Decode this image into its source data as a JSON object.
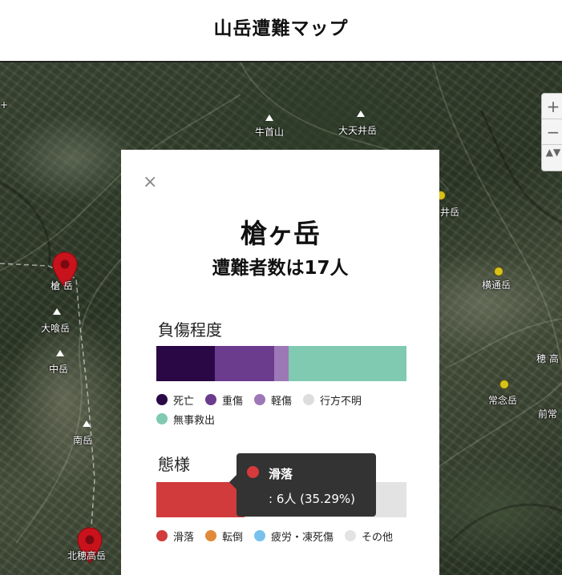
{
  "header": {
    "title": "山岳遭難マップ"
  },
  "map": {
    "labels": {
      "gyukubiyama": "牛首山",
      "daitenjo": "大天井岳",
      "ji_fragment": "井岳",
      "yokotoshi": "横通岳",
      "hotaka": "穂 高",
      "jonen": "常念岳",
      "mae": "前常",
      "yari": "槍 岳",
      "obami": "大喰岳",
      "naka": "中岳",
      "minami": "南岳",
      "kitaho": "北穂高岳"
    },
    "zoom": {
      "in": "+",
      "out": "−",
      "reset": "▲▼"
    }
  },
  "popup": {
    "close": "×",
    "title": "槍ヶ岳",
    "subtitle": "遭難者数は17人",
    "injury": {
      "heading": "負傷程度",
      "segments": [
        {
          "name": "死亡",
          "color": "#2a0845",
          "value": 4
        },
        {
          "name": "重傷",
          "color": "#6b3b8d",
          "value": 4
        },
        {
          "name": "軽傷",
          "color": "#9d78b6",
          "value": 1
        },
        {
          "name": "行方不明",
          "color": "#dddddd",
          "value": 0
        },
        {
          "name": "無事救出",
          "color": "#7fcab0",
          "value": 8
        }
      ]
    },
    "mode": {
      "heading": "態様",
      "segments": [
        {
          "name": "滑落",
          "color": "#d13b3b",
          "value": 6
        },
        {
          "name": "転倒",
          "color": "#e08a3a",
          "value": 0
        },
        {
          "name": "疲労・凍死傷",
          "color": "#78c1ec",
          "value": 0
        },
        {
          "name": "その他",
          "color": "#e3e3e3",
          "value": 11
        }
      ]
    }
  },
  "tooltip": {
    "name": "滑落",
    "value": ": 6人 (35.29%)"
  }
}
